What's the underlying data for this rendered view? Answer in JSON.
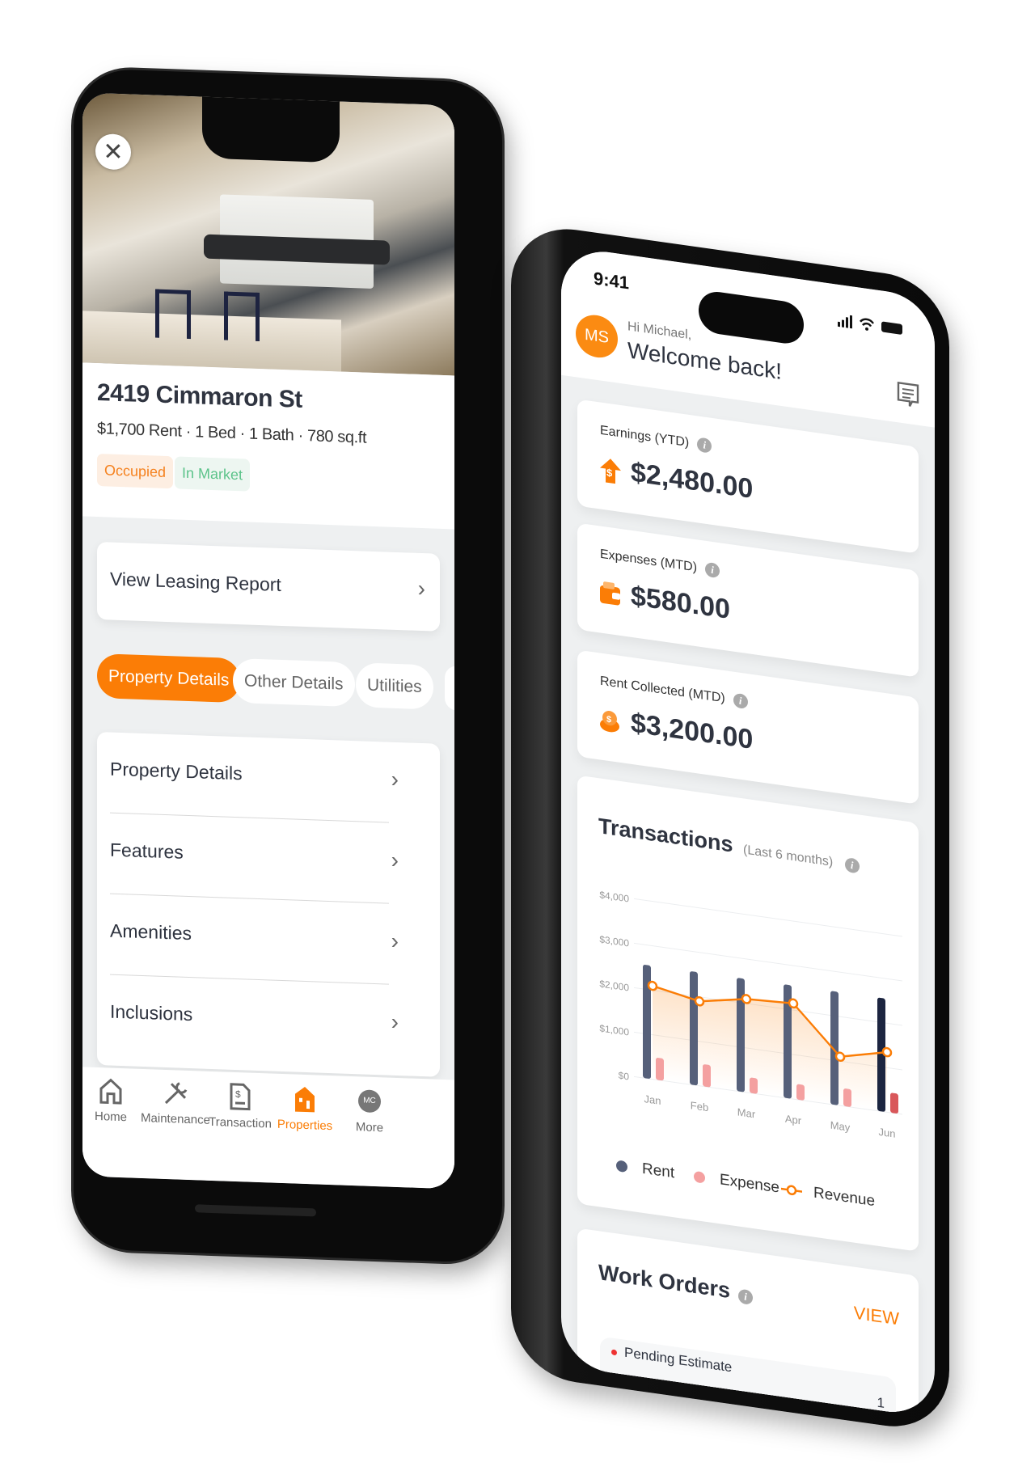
{
  "left_phone": {
    "close_icon": "close-icon",
    "property": {
      "title": "2419 Cimmaron St",
      "subtitle": "$1,700 Rent · 1 Bed · 1 Bath · 780 sq.ft",
      "badges": [
        {
          "label": "Occupied",
          "color": "#f5821f",
          "bg": "#fdeee2"
        },
        {
          "label": "In Market",
          "color": "#5cc38a",
          "bg": "#edf6f1"
        }
      ]
    },
    "leasing_report": "View Leasing Report",
    "tabs": [
      {
        "label": "Property Details",
        "active": true
      },
      {
        "label": "Other Details",
        "active": false
      },
      {
        "label": "Utilities",
        "active": false
      }
    ],
    "detail_rows": [
      "Property Details",
      "Features",
      "Amenities",
      "Inclusions"
    ],
    "nav": [
      {
        "label": "Home",
        "icon": "home-icon",
        "active": false
      },
      {
        "label": "Maintenance",
        "icon": "tools-icon",
        "active": false
      },
      {
        "label": "Transaction",
        "icon": "invoice-icon",
        "active": false
      },
      {
        "label": "Properties",
        "icon": "building-icon",
        "active": true
      },
      {
        "label": "More",
        "icon": "avatar-icon",
        "avatar_initials": "MC",
        "active": false
      }
    ]
  },
  "right_phone": {
    "status_time": "9:41",
    "avatar_initials": "MS",
    "greeting": "Hi Michael,",
    "welcome": "Welcome back!",
    "stats": [
      {
        "label": "Earnings (YTD)",
        "value": "$2,480.00",
        "icon": "dollar-arrow-up-icon"
      },
      {
        "label": "Expenses (MTD)",
        "value": "$580.00",
        "icon": "wallet-icon"
      },
      {
        "label": "Rent Collected (MTD)",
        "value": "$3,200.00",
        "icon": "coins-icon"
      }
    ],
    "transactions": {
      "title": "Transactions",
      "subtitle": "(Last 6 months)"
    },
    "work_orders": {
      "title": "Work Orders",
      "view_label": "VIEW",
      "first_item": "Pending Estimate",
      "first_count": "1"
    }
  },
  "colors": {
    "accent": "#fb7d06",
    "rent": "#56607a",
    "expense": "#f4a0a0",
    "revenue": "#fb7d06",
    "text": "#2f3440"
  },
  "chart_data": {
    "type": "bar",
    "categories": [
      "Jan",
      "Feb",
      "Mar",
      "Apr",
      "May",
      "Jun"
    ],
    "y_ticks": [
      "$0",
      "$1,000",
      "$2,000",
      "$3,000",
      "$4,000"
    ],
    "ylim": [
      0,
      4000
    ],
    "grid": true,
    "legend": "bottom",
    "series": [
      {
        "name": "Rent",
        "type": "bar",
        "values": [
          2550,
          2550,
          2550,
          2550,
          2550,
          2550
        ]
      },
      {
        "name": "Expense",
        "type": "bar",
        "values": [
          500,
          500,
          350,
          350,
          400,
          450
        ]
      },
      {
        "name": "Revenue",
        "type": "line",
        "values": [
          2100,
          1900,
          2100,
          2150,
          1100,
          1350
        ]
      }
    ]
  }
}
